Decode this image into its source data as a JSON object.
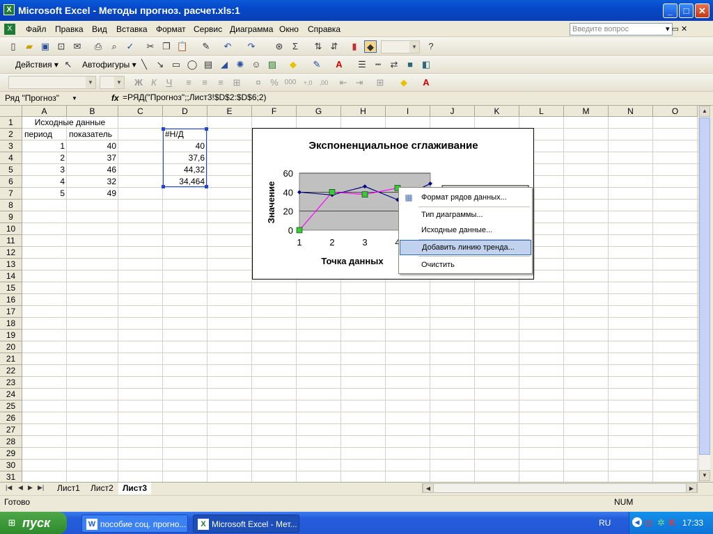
{
  "window": {
    "title": "Microsoft Excel - Методы прогноз. расчет.xls:1",
    "min": "_",
    "max": "□",
    "close": "✕"
  },
  "menu": {
    "items": [
      "Файл",
      "Правка",
      "Вид",
      "Вставка",
      "Формат",
      "Сервис",
      "Диаграмма",
      "Окно",
      "Справка"
    ],
    "ask_placeholder": "Введите вопрос",
    "win_controls": "▾ ▭ ✕"
  },
  "toolbar2": {
    "actions_label": "Действия ▾",
    "autoshapes_label": "Автофигуры ▾"
  },
  "formula_bar": {
    "name": "Ряд \"Прогноз\"",
    "fx": "fx",
    "formula": "=РЯД(\"Прогноз\";;Лист3!$D$2:$D$6;2)"
  },
  "grid": {
    "columns": [
      "A",
      "B",
      "C",
      "D",
      "E",
      "F",
      "G",
      "H",
      "I",
      "J",
      "K",
      "L",
      "M",
      "N",
      "O"
    ],
    "rows": [
      "1",
      "2",
      "3",
      "4",
      "5",
      "6",
      "7",
      "8",
      "9",
      "10",
      "11",
      "12",
      "13",
      "14",
      "15",
      "16",
      "17",
      "18",
      "19",
      "20",
      "21",
      "22",
      "23",
      "24",
      "25",
      "26",
      "27",
      "28",
      "29",
      "30",
      "31"
    ],
    "cells": {
      "header_title": "Исходные данные",
      "col_a_header": "период",
      "col_b_header": "показатель",
      "periods": [
        "1",
        "2",
        "3",
        "4",
        "5"
      ],
      "values": [
        "40",
        "37",
        "46",
        "32",
        "49"
      ],
      "d2": "#Н/Д",
      "forecast": [
        "40",
        "37,6",
        "44,32",
        "34,464"
      ]
    }
  },
  "chart": {
    "title": "Экспоненциальное сглаживание",
    "xlabel": "Точка данных",
    "ylabel": "Значение",
    "y_ticks": [
      "0",
      "20",
      "40",
      "60"
    ],
    "x_ticks": [
      "1",
      "2",
      "3",
      "4"
    ]
  },
  "chart_data": {
    "type": "line",
    "title": "Экспоненциальное сглаживание",
    "xlabel": "Точка данных",
    "ylabel": "Значение",
    "x": [
      1,
      2,
      3,
      4,
      5
    ],
    "ylim": [
      0,
      60
    ],
    "series": [
      {
        "values": [
          40,
          37,
          46,
          32,
          49
        ],
        "color": "#000080"
      },
      {
        "values": [
          0,
          40,
          37.6,
          44.32,
          34.464
        ],
        "color": "#FF00FF"
      }
    ]
  },
  "context_menu": {
    "items": [
      "Формат рядов данных...",
      "Тип диаграммы...",
      "Исходные данные...",
      "Добавить линию тренда...",
      "Очистить"
    ]
  },
  "sheets": {
    "tabs": [
      "Лист1",
      "Лист2",
      "Лист3"
    ]
  },
  "status": {
    "ready": "Готово",
    "num": "NUM"
  },
  "taskbar": {
    "start": "пуск",
    "tasks": [
      "пособие соц. прогно...",
      "Microsoft Excel - Мет..."
    ],
    "lang": "RU",
    "clock": "17:33"
  },
  "colors": {
    "series1": "#000080",
    "series2": "#FF00FF",
    "marker2": "#33CC33",
    "plot_area": "#C0C0C0",
    "selection": "#2148C7",
    "menu_highlight": "#C1D2EE"
  }
}
